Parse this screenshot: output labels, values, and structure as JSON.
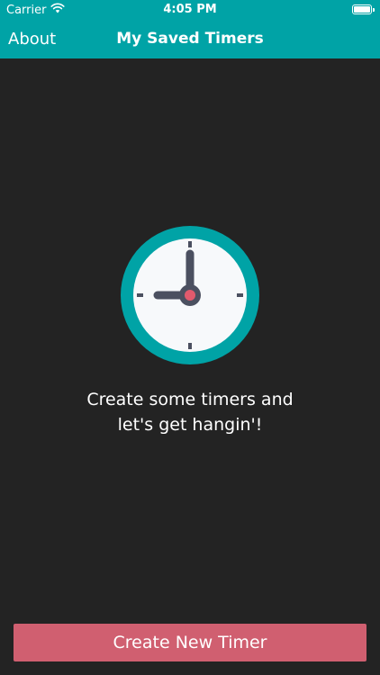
{
  "status_bar": {
    "carrier": "Carrier",
    "time": "4:05 PM",
    "wifi_icon": "wifi-icon",
    "battery_icon": "battery-icon"
  },
  "nav": {
    "left_label": "About",
    "title": "My Saved Timers"
  },
  "empty_state": {
    "icon": "clock-icon",
    "line1": "Create some timers and",
    "line2": "let's get hangin'!"
  },
  "actions": {
    "create_label": "Create New Timer"
  },
  "colors": {
    "header_bg": "#00a3a6",
    "page_bg": "#232323",
    "button_bg": "#d05f70",
    "clock_ring": "#00a3a6",
    "clock_face": "#f7f9fb",
    "clock_hands": "#4b5060",
    "clock_center": "#e05a6d"
  }
}
